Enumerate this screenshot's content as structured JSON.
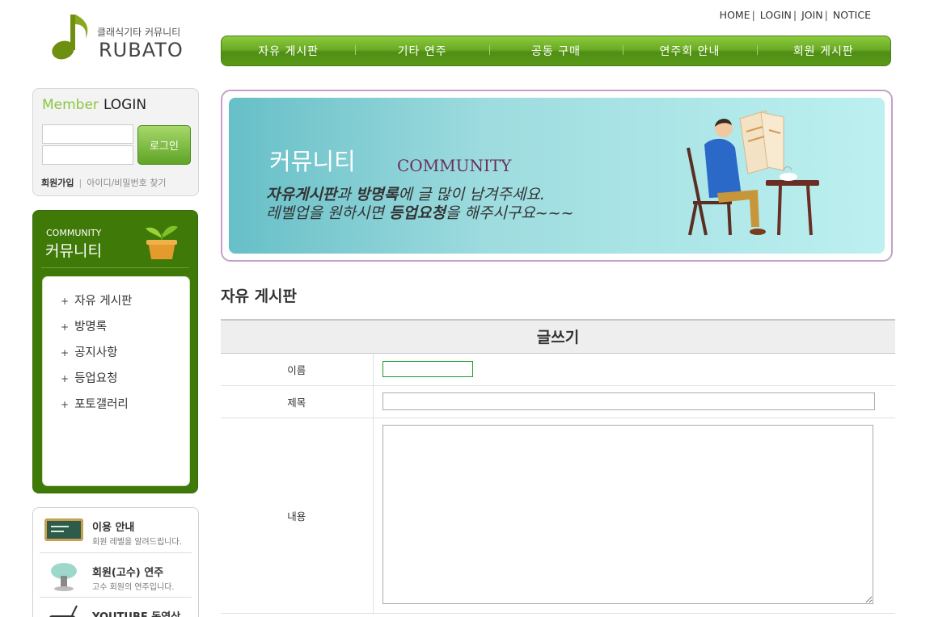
{
  "header": {
    "logo_sub": "클래식기타 커뮤니티",
    "logo_brand": "RUBATO",
    "util_nav": [
      "HOME",
      "LOGIN",
      "JOIN",
      "NOTICE"
    ]
  },
  "gnb": [
    "자유 게시판",
    "기타 연주",
    "공동 구매",
    "연주회 안내",
    "회원 게시판"
  ],
  "login": {
    "title_a": "Member",
    "title_b": "LOGIN",
    "button": "로그인",
    "join": "회원가입",
    "find": "아이디/비밀번호 찾기"
  },
  "community": {
    "en": "COMMUNITY",
    "ko": "커뮤니티",
    "items": [
      "자유 게시판",
      "방명록",
      "공지사항",
      "등업요청",
      "포토갤러리"
    ]
  },
  "info": [
    {
      "title": "이용 안내",
      "desc": "회원 레벨을 알려드립니다."
    },
    {
      "title": "회원(고수) 연주",
      "desc": "고수 회원의 연주입니다."
    },
    {
      "title": "YOUTUBE 동영상",
      "desc": ""
    }
  ],
  "banner": {
    "ko": "커뮤니티",
    "en": "COMMUNITY",
    "line1_a": "자유게시판",
    "line1_b": "과 ",
    "line1_c": "방명록",
    "line1_d": "에 글 많이 남겨주세요.",
    "line2_a": "레벨업을 원하시면 ",
    "line2_b": "등업요청",
    "line2_c": "을 해주시구요~~~"
  },
  "board": {
    "title": "자유 게시판",
    "form_title": "글쓰기",
    "name_label": "이름",
    "subject_label": "제목",
    "content_label": "내용",
    "name_value": "",
    "subject_value": "",
    "content_value": ""
  }
}
